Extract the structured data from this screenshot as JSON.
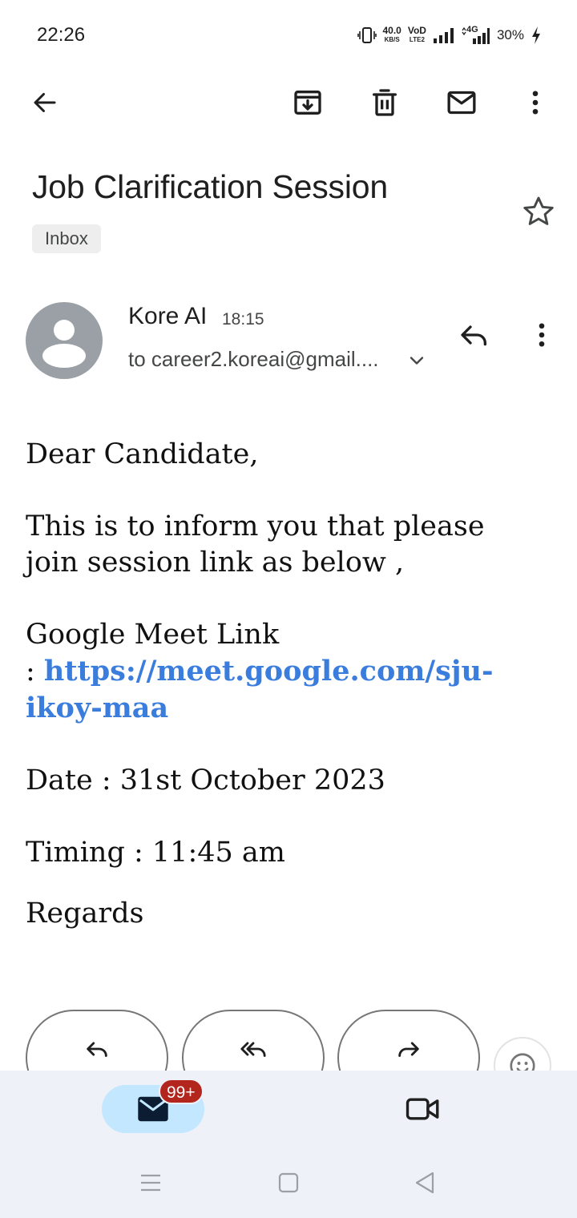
{
  "status_bar": {
    "time": "22:26",
    "net_speed": "40.0",
    "net_unit": "KB/S",
    "volte_top": "VoD",
    "volte_bottom": "LTE2",
    "network": "4G",
    "battery": "30%"
  },
  "toolbar": {
    "back_icon": "arrow-left-icon",
    "archive_icon": "archive-icon",
    "delete_icon": "trash-icon",
    "mark_unread_icon": "mail-icon",
    "more_icon": "more-vert-icon"
  },
  "email": {
    "subject": "Job Clarification Session",
    "label": "Inbox",
    "sender_name": "Kore AI",
    "time": "18:15",
    "recipient": "to career2.koreai@gmail....",
    "body": {
      "greeting": "Dear Candidate,",
      "line1": "This is to inform you that please join session link as below ,",
      "meet_label": "Google Meet Link",
      "meet_prefix": ": ",
      "meet_link": "https://meet.google.com/sju-ikoy-maa",
      "date": "Date : 31st October 2023",
      "timing": "Timing : 11:45 am",
      "regards": "Regards"
    }
  },
  "actions": {
    "reply_icon": "reply-icon",
    "reply_all_icon": "reply-all-icon",
    "forward_icon": "forward-icon",
    "emoji_icon": "emoji-icon"
  },
  "bottom_nav": {
    "mail_badge": "99+",
    "mail_icon": "mail-icon",
    "meet_icon": "video-camera-icon"
  },
  "colors": {
    "link": "#3b7ddd",
    "active_nav": "#c2e7ff",
    "badge": "#b3261e",
    "nav_bg": "#eef1f7"
  }
}
